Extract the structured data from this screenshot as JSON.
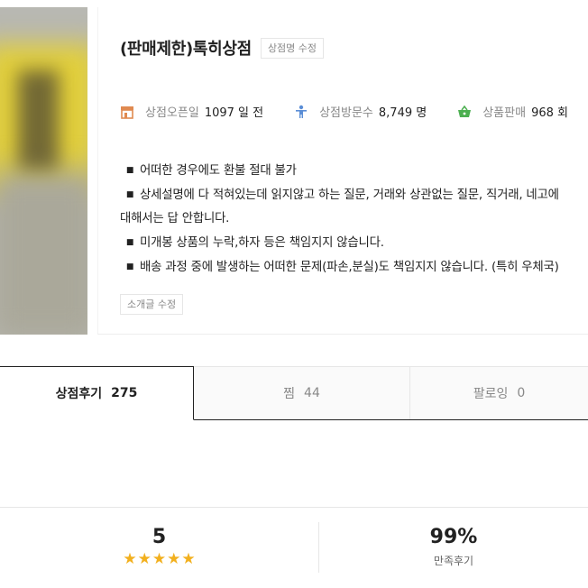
{
  "shop": {
    "name": "(판매제한)톡히상점",
    "name_edit_label": "상점명 수정",
    "intro_edit_label": "소개글 수정"
  },
  "stats": [
    {
      "icon": "store-icon",
      "label": "상점오픈일",
      "value": "1097 일 전",
      "color": "#e08a50"
    },
    {
      "icon": "visitor-icon",
      "label": "상점방문수",
      "value": "8,749 명",
      "color": "#5b8ed6"
    },
    {
      "icon": "basket-icon",
      "label": "상품판매",
      "value": "968 회",
      "color": "#4caf50"
    }
  ],
  "intro": {
    "bullet": "■",
    "lines": [
      {
        "bullet": true,
        "text": "어떠한 경우에도 환불 절대 불가"
      },
      {
        "bullet": true,
        "text": "상세설명에 다 적혀있는데 읽지않고 하는 질문, 거래와 상관없는 질문, 직거래, 네고에"
      },
      {
        "bullet": false,
        "text": "대해서는 답 안합니다."
      },
      {
        "bullet": true,
        "text": "미개봉 상품의 누락,하자 등은 책임지지 않습니다."
      },
      {
        "bullet": true,
        "text": "배송 과정 중에 발생하는 어떠한 문제(파손,분실)도 책임지지 않습니다. (특히 우체국)"
      }
    ]
  },
  "tabs": [
    {
      "label": "상점후기",
      "count": "275",
      "active": true
    },
    {
      "label": "찜",
      "count": "44",
      "active": false
    },
    {
      "label": "팔로잉",
      "count": "0",
      "active": false
    }
  ],
  "summary": {
    "rating": "5",
    "stars": 5,
    "star_glyph": "★",
    "star_color": "#f2b01e",
    "satisfaction": "99%",
    "satisfaction_label": "만족후기"
  }
}
